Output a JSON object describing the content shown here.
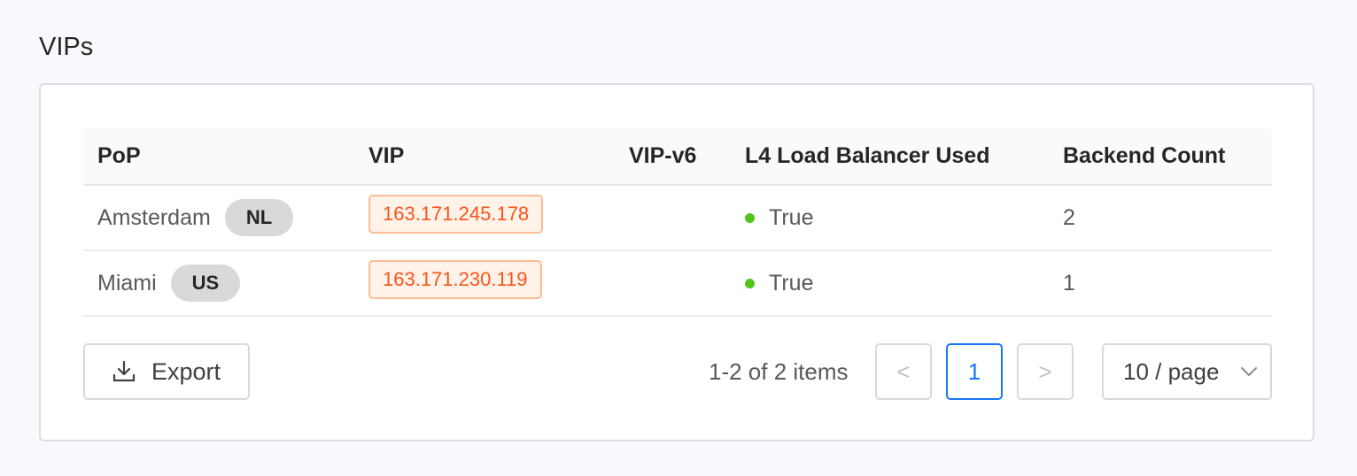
{
  "section": {
    "title": "VIPs"
  },
  "table": {
    "columns": [
      "PoP",
      "VIP",
      "VIP-v6",
      "L4 Load Balancer Used",
      "Backend Count"
    ],
    "rows": [
      {
        "pop": "Amsterdam",
        "country": "NL",
        "vip": "163.171.245.178",
        "vip_v6": "",
        "l4_used": "True",
        "backend_count": "2"
      },
      {
        "pop": "Miami",
        "country": "US",
        "vip": "163.171.230.119",
        "vip_v6": "",
        "l4_used": "True",
        "backend_count": "1"
      }
    ]
  },
  "footer": {
    "export_label": "Export",
    "total_text": "1-2 of 2 items",
    "prev_label": "<",
    "current_page": "1",
    "next_label": ">",
    "page_size": "10 / page"
  },
  "colors": {
    "accent": "#1677ff",
    "ip_tag_text": "#fa541c",
    "status_true": "#52c41a"
  },
  "icons": {
    "export": "download-icon",
    "status": "green-dot-icon",
    "select": "chevron-down-icon"
  }
}
